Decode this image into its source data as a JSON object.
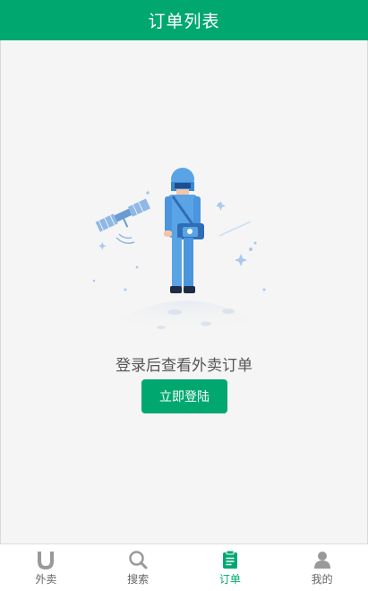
{
  "header": {
    "title": "订单列表"
  },
  "empty_state": {
    "message": "登录后查看外卖订单",
    "login_label": "立即登陆"
  },
  "tabbar": {
    "items": [
      {
        "label": "外卖",
        "icon": "waimai-u-icon",
        "active": false
      },
      {
        "label": "搜索",
        "icon": "search-icon",
        "active": false
      },
      {
        "label": "订单",
        "icon": "clipboard-icon",
        "active": true
      },
      {
        "label": "我的",
        "icon": "user-icon",
        "active": false
      }
    ]
  },
  "colors": {
    "brand": "#00a870",
    "inactive": "#999999",
    "background": "#f5f5f5"
  }
}
